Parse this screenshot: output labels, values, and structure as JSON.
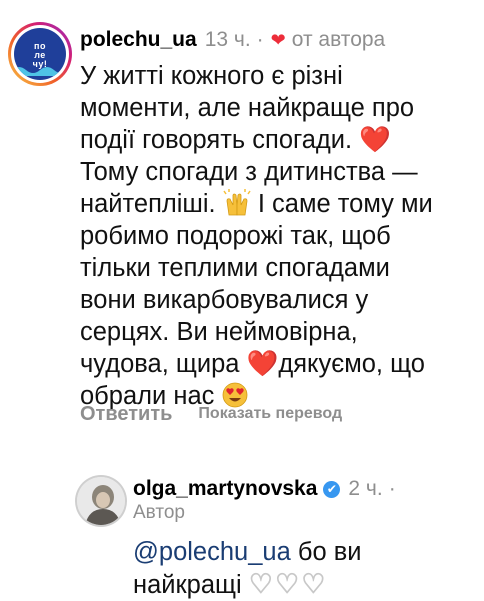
{
  "comment": {
    "username": "polechu_ua",
    "time": "13 ч.",
    "separator": "·",
    "author_badge": "от автора",
    "avatar_logo_line1": "по",
    "avatar_logo_line2": "ле",
    "avatar_logo_line3": "чу!",
    "text_1": "У житті кожного є різні моменти, але найкраще про події говорять спогади.",
    "text_2": "Тому спогади з дитинства — найтепліші.",
    "text_3": "І саме тому ми робимо подорожі так, щоб тільки теплими спогадами вони викарбовувалися у серцях. Ви неймовірна, чудова, щира",
    "text_4": "дякуємо, що обрали нас",
    "reply_label": "Ответить",
    "translate_label": "Показать перевод",
    "heart_color": "#ed2d3a"
  },
  "reply": {
    "username": "olga_martynovska",
    "verified": "✔",
    "time": "2 ч.",
    "separator": "·",
    "author_label": "Автор",
    "mention": "@polechu_ua",
    "text": "бо ви найкращі",
    "hearts": "♡♡♡"
  }
}
